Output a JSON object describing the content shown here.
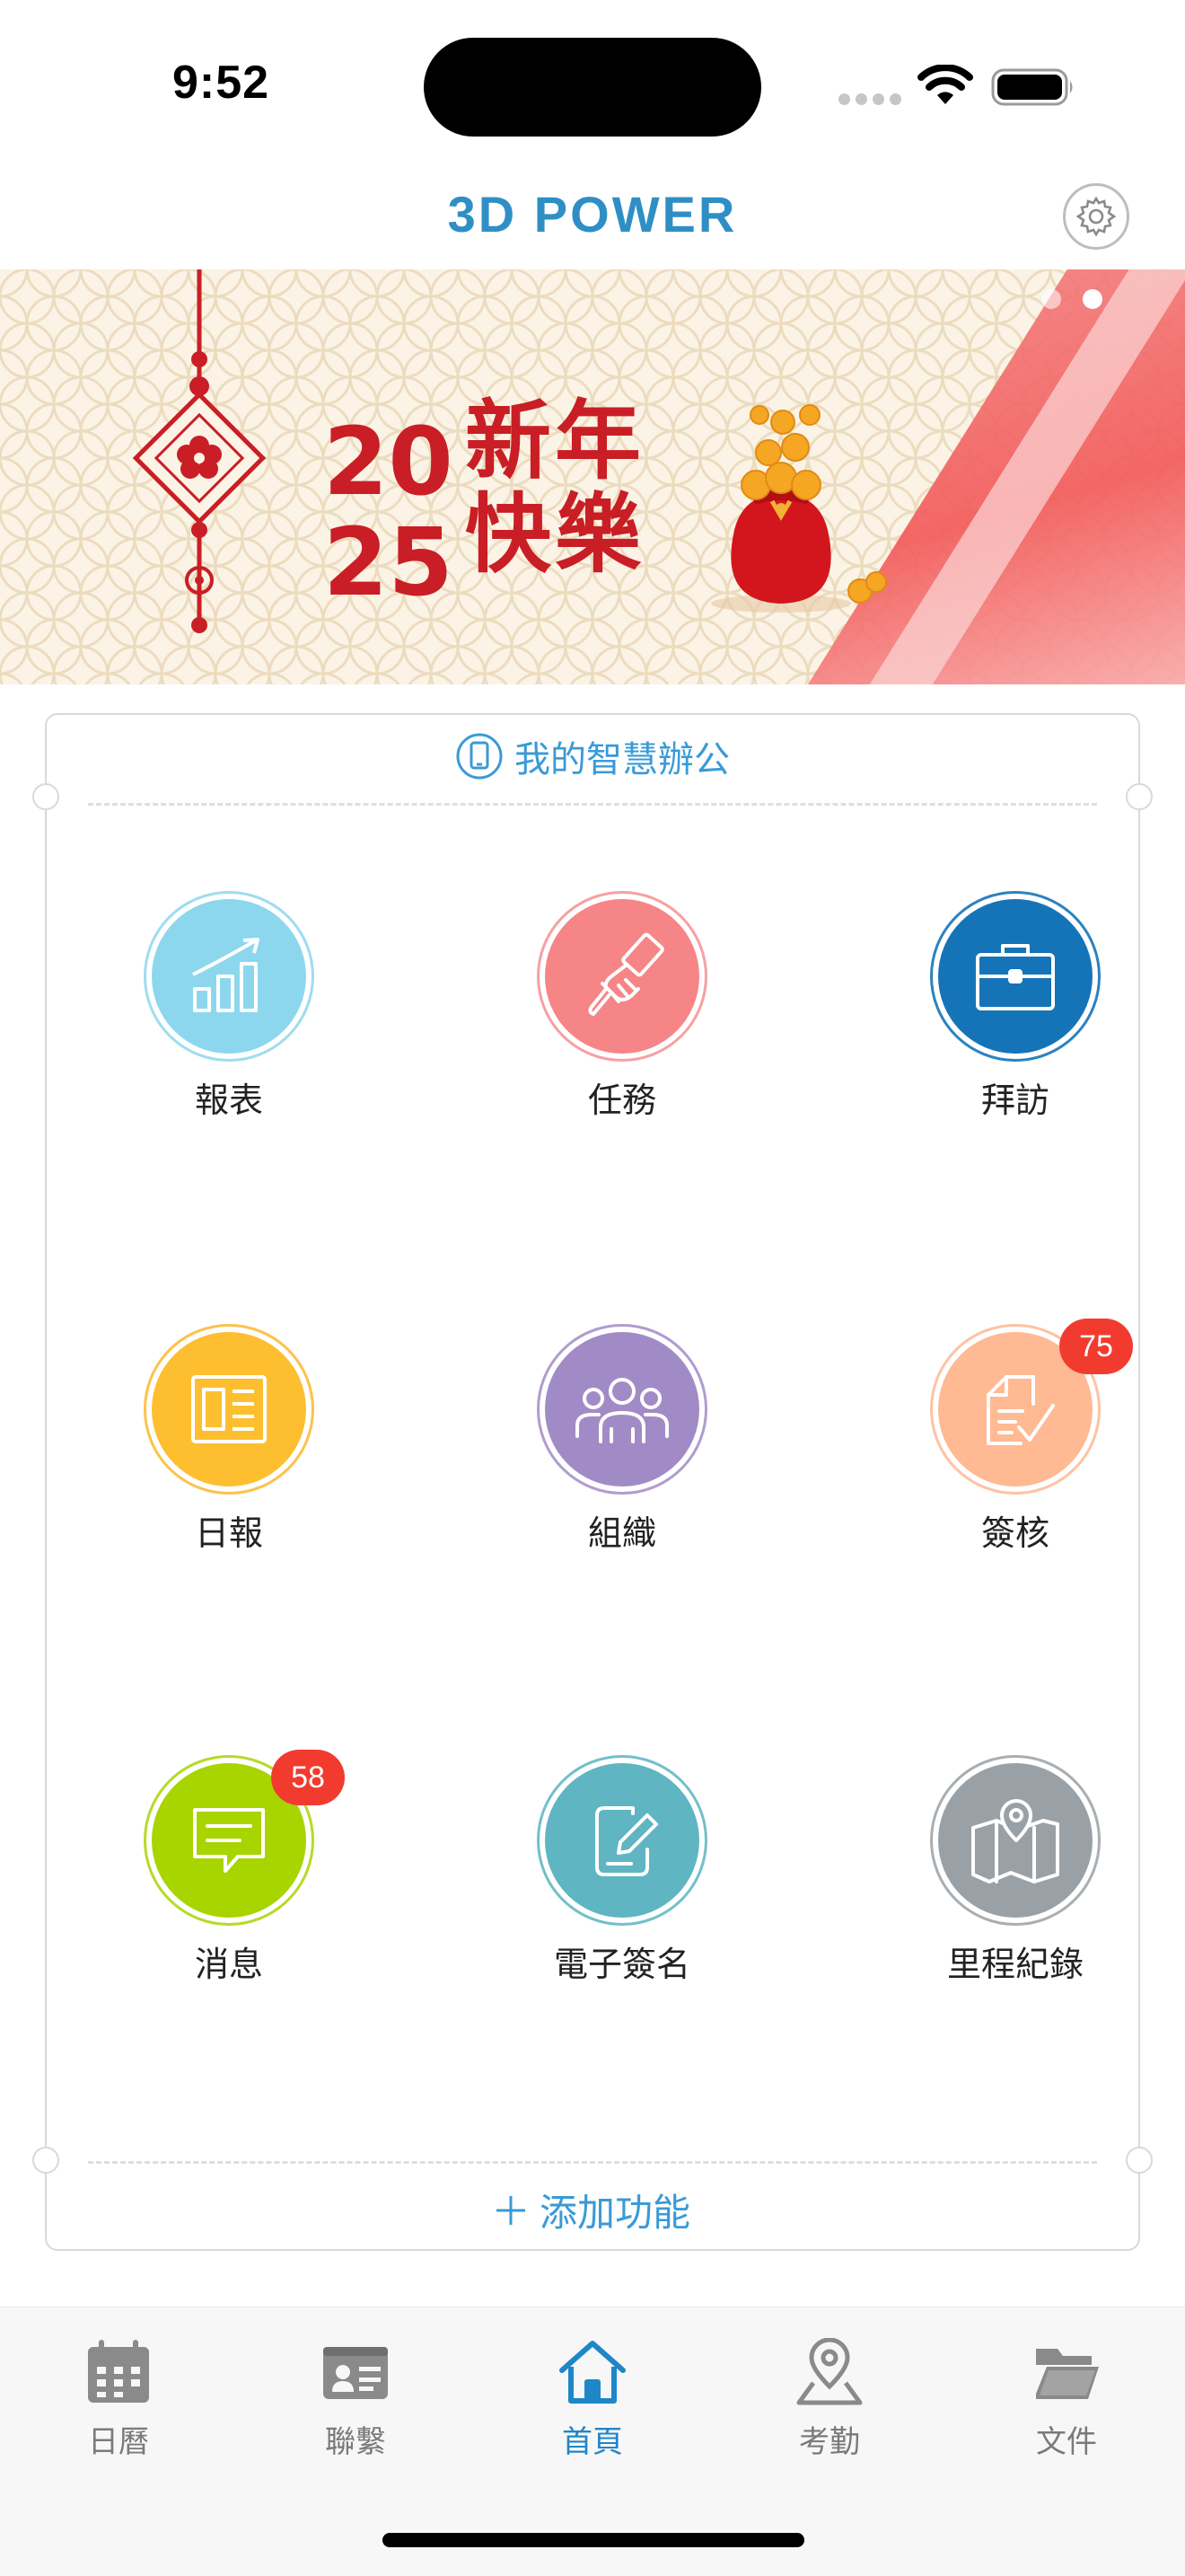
{
  "status_bar": {
    "time": "9:52"
  },
  "header": {
    "title": "3D POWER",
    "settings_icon": "gear-icon"
  },
  "banner": {
    "year_top": "20",
    "year_bottom": "25",
    "greeting_line1": "新年",
    "greeting_line2": "快樂",
    "carousel_pages": 2,
    "carousel_active_index": 1
  },
  "card": {
    "title": "我的智慧辦公",
    "title_icon": "phone-icon",
    "tiles": [
      {
        "label": "報表",
        "icon": "chart-growth-icon",
        "color": "#8dd7ee",
        "ring": "#9fdcf0",
        "badge": ""
      },
      {
        "label": "任務",
        "icon": "pointing-hand-icon",
        "color": "#f58587",
        "ring": "#f6a0a2",
        "badge": ""
      },
      {
        "label": "拜訪",
        "icon": "briefcase-icon",
        "color": "#1574b8",
        "ring": "#2b82c0",
        "badge": ""
      },
      {
        "label": "日報",
        "icon": "newspaper-icon",
        "color": "#fdbf30",
        "ring": "#fcc24a",
        "badge": ""
      },
      {
        "label": "組織",
        "icon": "people-group-icon",
        "color": "#a18bc6",
        "ring": "#b09ccf",
        "badge": ""
      },
      {
        "label": "簽核",
        "icon": "document-check-icon",
        "color": "#ffb993",
        "ring": "#ffc2a3",
        "badge": "75"
      },
      {
        "label": "消息",
        "icon": "message-icon",
        "color": "#a8d400",
        "ring": "#b5db26",
        "badge": "58"
      },
      {
        "label": "電子簽名",
        "icon": "signature-pen-icon",
        "color": "#5fb5c2",
        "ring": "#73bfca",
        "badge": ""
      },
      {
        "label": "里程紀錄",
        "icon": "map-pin-icon",
        "color": "#9aa1a6",
        "ring": "#a8aeb2",
        "badge": ""
      }
    ],
    "add_label": "添加功能"
  },
  "tab_bar": {
    "active_color": "#1f86c8",
    "inactive_color": "#7a7a7a",
    "items": [
      {
        "label": "日曆",
        "icon": "calendar-icon",
        "active": false
      },
      {
        "label": "聯繫",
        "icon": "contact-card-icon",
        "active": false
      },
      {
        "label": "首頁",
        "icon": "home-icon",
        "active": true
      },
      {
        "label": "考勤",
        "icon": "location-pin-icon",
        "active": false
      },
      {
        "label": "文件",
        "icon": "folder-icon",
        "active": false
      }
    ]
  }
}
